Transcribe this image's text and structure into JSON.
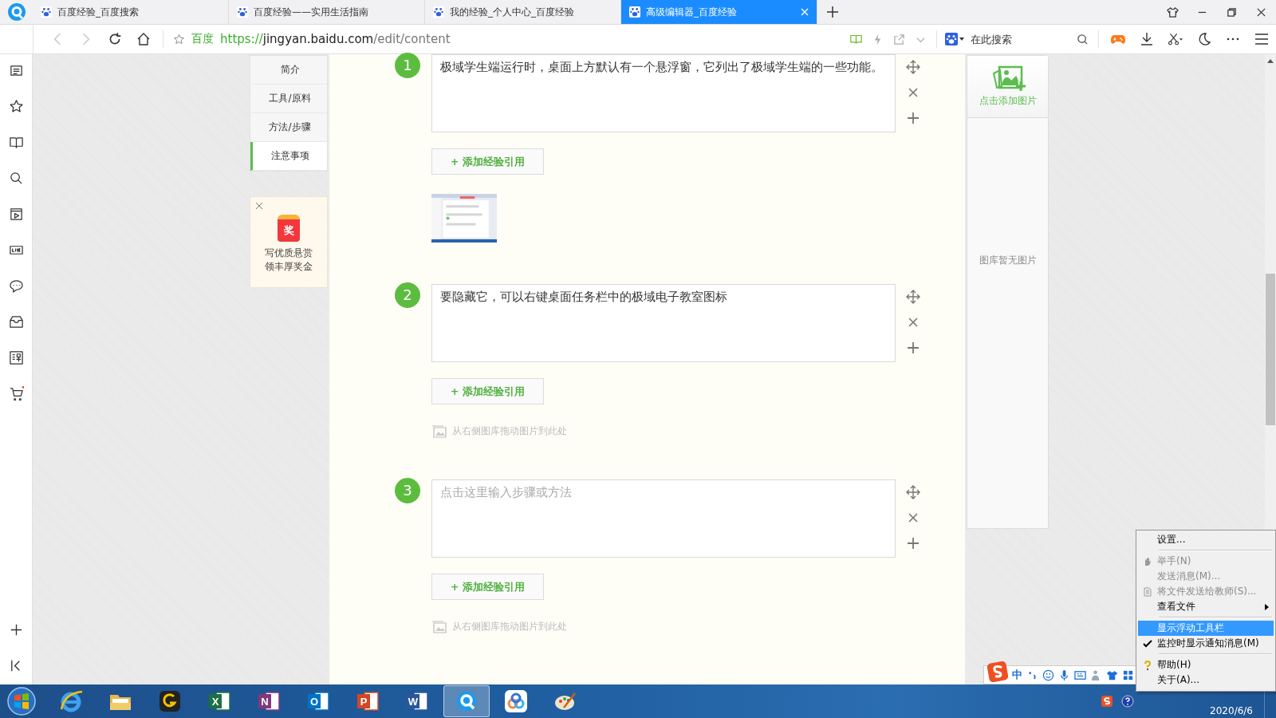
{
  "browser": {
    "tabs": [
      {
        "title": "百度经验_百度搜索",
        "selected": false
      },
      {
        "title": "百度经验——实用生活指南",
        "selected": false
      },
      {
        "title": "我的经验_个人中心_百度经验",
        "selected": false
      },
      {
        "title": "高级编辑器_百度经验",
        "selected": true
      }
    ],
    "address": {
      "site_label": "百度",
      "url_scheme": "https://",
      "url_host": "jingyan.baidu.com",
      "url_path": "/edit/content"
    },
    "search": {
      "placeholder": "在此搜索"
    }
  },
  "nav": {
    "items": [
      {
        "label": "简介",
        "selected": false
      },
      {
        "label": "工具/原料",
        "selected": false
      },
      {
        "label": "方法/步骤",
        "selected": false
      },
      {
        "label": "注意事项",
        "selected": true
      }
    ]
  },
  "promo": {
    "badge": "奖",
    "lines": [
      "写优质悬赏",
      "领丰厚奖金"
    ]
  },
  "steps": [
    {
      "number": "1",
      "text": "极域学生端运行时，桌面上方默认有一个悬浮窗，它列出了极域学生端的一些功能。",
      "add_reference": "+ 添加经验引用"
    },
    {
      "number": "2",
      "text": "要隐藏它，可以右键桌面任务栏中的极域电子教室图标",
      "add_reference": "+ 添加经验引用",
      "attachment": {
        "kind": "hint",
        "text": "从右侧图库拖动图片到此处"
      }
    },
    {
      "number": "3",
      "placeholder": "点击这里输入步骤或方法",
      "add_reference": "+ 添加经验引用",
      "attachment": {
        "kind": "hint",
        "text": "从右侧图库拖动图片到此处"
      }
    }
  ],
  "image_panel": {
    "add_label": "点击添加图片",
    "empty_text": "图库暂无图片"
  },
  "ime_toolbar": {
    "mode": "中"
  },
  "context_menu": {
    "items": [
      {
        "kind": "item",
        "label": "设置...",
        "disabled": false,
        "checked": false,
        "submenu": false,
        "selected": false
      },
      {
        "kind": "separator"
      },
      {
        "kind": "item",
        "label": "举手(N)",
        "disabled": true,
        "checked": false,
        "submenu": false,
        "selected": false
      },
      {
        "kind": "item",
        "label": "发送消息(M)...",
        "disabled": true,
        "checked": false,
        "submenu": false,
        "selected": false
      },
      {
        "kind": "item",
        "label": "将文件发送给教师(S)...",
        "disabled": true,
        "checked": false,
        "submenu": false,
        "selected": false
      },
      {
        "kind": "item",
        "label": "查看文件",
        "disabled": false,
        "checked": false,
        "submenu": true,
        "selected": false
      },
      {
        "kind": "separator"
      },
      {
        "kind": "item",
        "label": "显示浮动工具栏",
        "disabled": false,
        "checked": false,
        "submenu": false,
        "selected": true
      },
      {
        "kind": "item",
        "label": "监控时显示通知消息(M)",
        "disabled": false,
        "checked": true,
        "submenu": false,
        "selected": false
      },
      {
        "kind": "separator"
      },
      {
        "kind": "item",
        "label": "帮助(H)",
        "disabled": false,
        "checked": false,
        "submenu": false,
        "selected": false
      },
      {
        "kind": "item",
        "label": "关于(A)...",
        "disabled": false,
        "checked": false,
        "submenu": false,
        "selected": false
      }
    ]
  },
  "taskbar": {
    "apps": [
      {
        "kind": "ie",
        "selected": false
      },
      {
        "kind": "folder",
        "selected": false
      },
      {
        "kind": "ring",
        "selected": false
      },
      {
        "kind": "office",
        "glyph": "X",
        "color": "#1e7145",
        "selected": false
      },
      {
        "kind": "office",
        "glyph": "N",
        "color": "#80397b",
        "selected": false
      },
      {
        "kind": "office",
        "glyph": "O",
        "color": "#0072c6",
        "selected": false
      },
      {
        "kind": "office",
        "glyph": "P",
        "color": "#d24726",
        "selected": false
      },
      {
        "kind": "office",
        "glyph": "W",
        "color": "#2b579a",
        "selected": false
      },
      {
        "kind": "browser",
        "selected": true
      },
      {
        "kind": "cloud",
        "selected": false
      },
      {
        "kind": "paint",
        "selected": false
      }
    ],
    "date": "2020/6/6"
  }
}
